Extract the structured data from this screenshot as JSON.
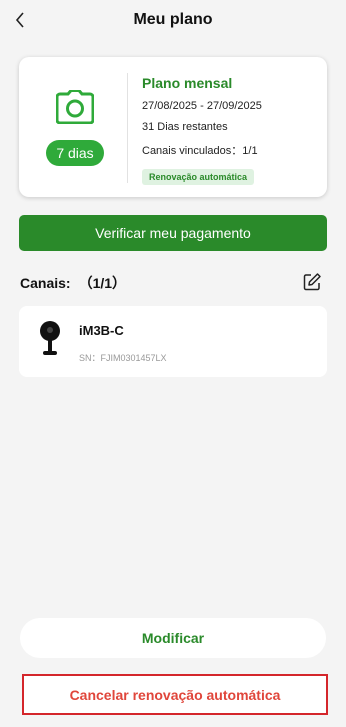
{
  "header": {
    "title": "Meu plano"
  },
  "plan": {
    "days_badge": "7 dias",
    "name": "Plano mensal",
    "period": "27/08/2025 - 27/09/2025",
    "remaining": "31 Dias restantes",
    "linked_channels": "Canais vinculados：1/1",
    "auto_renew_badge": "Renovação automática",
    "accent_color": "#2a8a2a"
  },
  "actions": {
    "verify_payment": "Verificar meu pagamento",
    "modify": "Modificar",
    "cancel_auto_renew": "Cancelar renovação automática"
  },
  "channels": {
    "label": "Canais:",
    "count": "（1/1）",
    "edit_icon": "edit-icon",
    "items": [
      {
        "name": "iM3B-C",
        "serial": "SN：FJIM0301457LX",
        "icon": "camera-device-icon"
      }
    ]
  }
}
